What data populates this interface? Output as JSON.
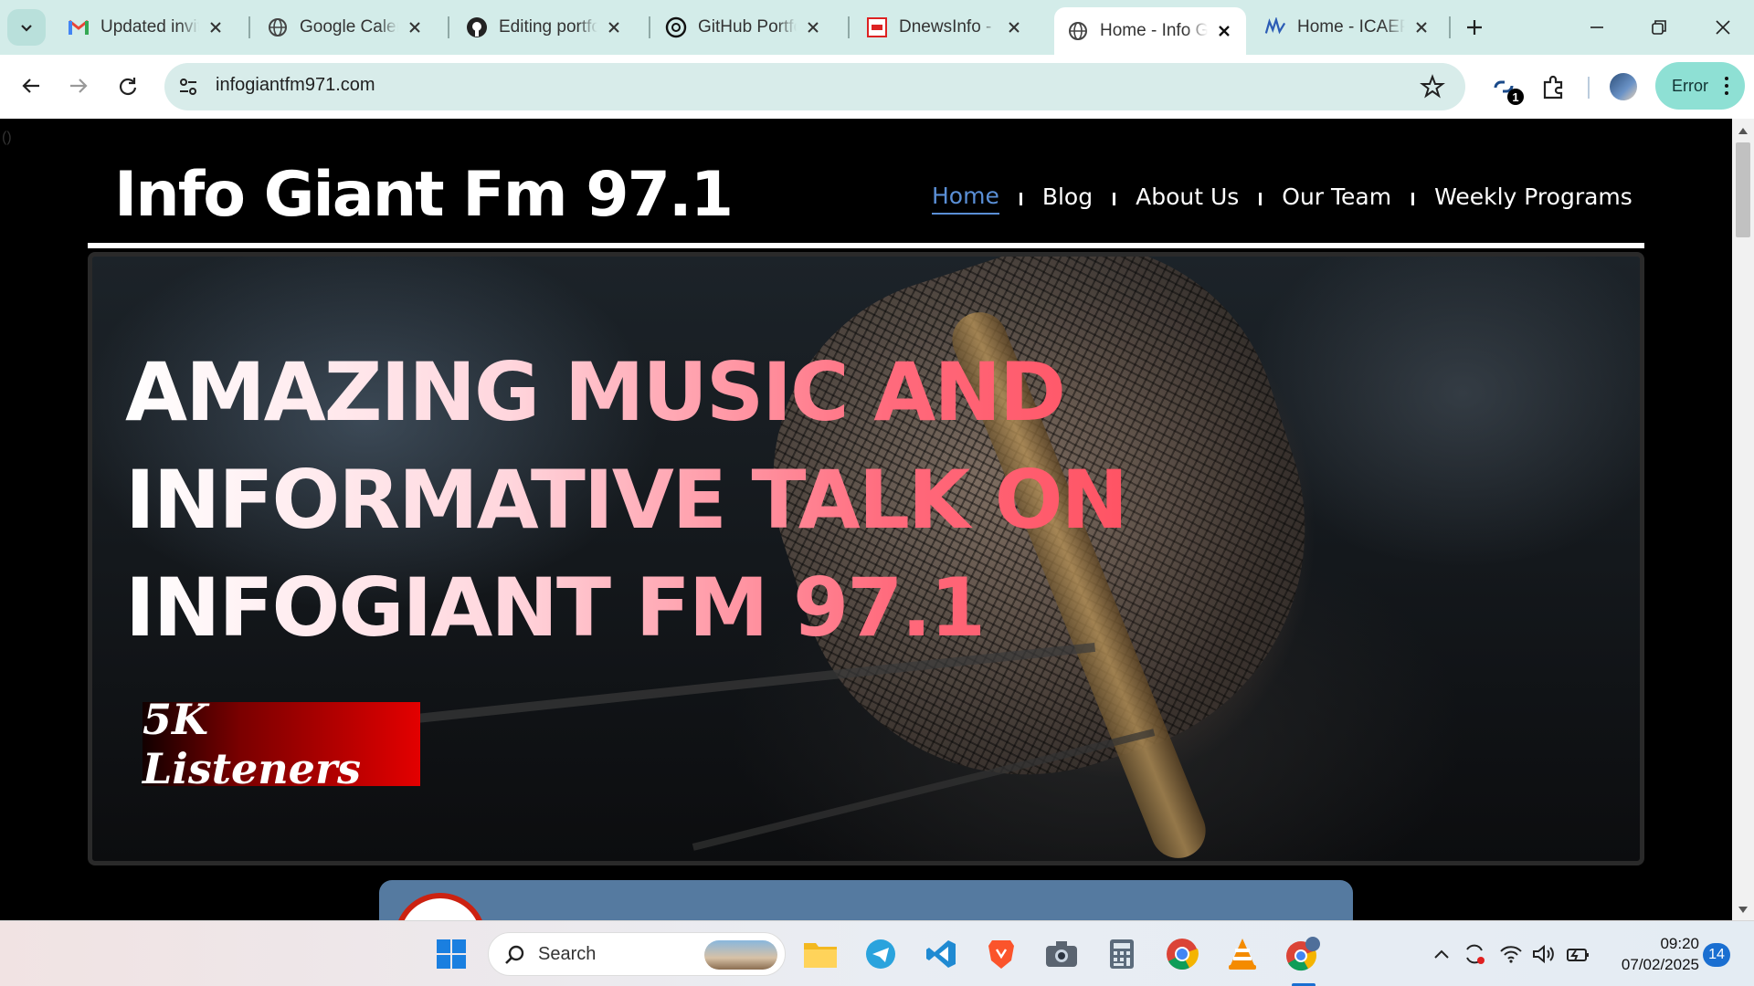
{
  "browser": {
    "tabs": [
      {
        "title": "Updated invita",
        "icon": "gmail-icon"
      },
      {
        "title": "Google Calend",
        "icon": "globe-icon"
      },
      {
        "title": "Editing portfol",
        "icon": "github-icon"
      },
      {
        "title": "GitHub Portfol",
        "icon": "openai-icon"
      },
      {
        "title": "DnewsInfo - B",
        "icon": "dnews-icon"
      },
      {
        "title": "Home - Info G",
        "icon": "globe-icon",
        "active": true
      },
      {
        "title": "Home - ICAEP",
        "icon": "icaep-icon"
      }
    ],
    "url": "infogiantfm971.com",
    "extension_badge": "1",
    "profile_button": "Error"
  },
  "page": {
    "stray_text": "()",
    "site_title": "Info Giant Fm 97.1",
    "nav": [
      "Home",
      "Blog",
      "About Us",
      "Our Team",
      "Weekly Programs"
    ],
    "hero_headline": "AMAZING MUSIC AND INFORMATIVE TALK ON INFOGIANT FM 97.1",
    "listeners_badge": "5K Listeners"
  },
  "taskbar": {
    "search_label": "Search",
    "apps": [
      "windows-start-icon",
      "file-explorer-icon",
      "telegram-icon",
      "vscode-icon",
      "brave-icon",
      "camera-icon",
      "calculator-icon",
      "chrome-icon",
      "vlc-icon",
      "chrome-profile-icon"
    ],
    "time": "09:20",
    "date": "07/02/2025",
    "notifications": "14"
  },
  "colors": {
    "tabstrip_bg": "#d3ece9",
    "omnibox_bg": "#d8ecea",
    "nav_active": "#5a8fd6",
    "headline_gradient_start": "#ffffff",
    "headline_gradient_end": "#ff4a5a",
    "badge_red": "#e30000",
    "card_blue": "#557aa0"
  }
}
